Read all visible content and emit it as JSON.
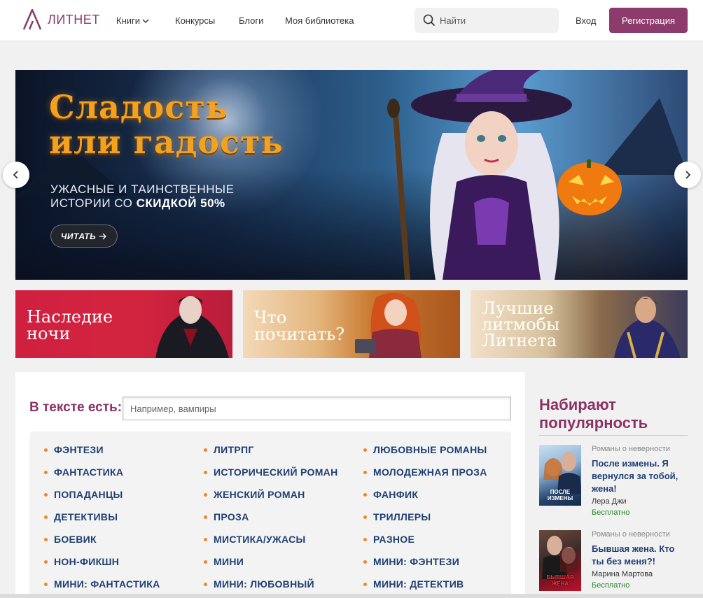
{
  "header": {
    "logo_text": "ЛИТНЕТ",
    "nav": {
      "books": "Книги",
      "contests": "Конкурсы",
      "blogs": "Блоги",
      "library": "Моя библиотека"
    },
    "search_placeholder": "Найти",
    "login": "Вход",
    "register": "Регистрация"
  },
  "hero": {
    "title_line1": "Сладость",
    "title_line2": "или гадость",
    "subtitle_line1": "УЖАСНЫЕ И ТАИНСТВЕННЫЕ",
    "subtitle_line2_plain": "ИСТОРИИ СО ",
    "subtitle_line2_bold": "СКИДКОЙ 50%",
    "button": "ЧИТАТЬ"
  },
  "promos": [
    {
      "line1": "Наследие",
      "line2": "ночи"
    },
    {
      "line1": "Что",
      "line2": "почитать?"
    },
    {
      "line1": "Лучшие",
      "line2": "литмобы",
      "line3": "Литнета"
    }
  ],
  "search_in_text": {
    "label": "В тексте есть:",
    "placeholder": "Например, вампиры"
  },
  "genres": {
    "col1": [
      "ФЭНТЕЗИ",
      "ФАНТАСТИКА",
      "ПОПАДАНЦЫ",
      "ДЕТЕКТИВЫ",
      "БОЕВИК",
      "НОН-ФИКШН",
      "МИНИ: ФАНТАСТИКА"
    ],
    "col2": [
      "ЛИТРПГ",
      "ИСТОРИЧЕСКИЙ РОМАН",
      "ЖЕНСКИЙ РОМАН",
      "ПРОЗА",
      "МИСТИКА/УЖАСЫ",
      "МИНИ",
      "МИНИ: ЛЮБОВНЫЙ"
    ],
    "col3": [
      "ЛЮБОВНЫЕ РОМАНЫ",
      "МОЛОДЕЖНАЯ ПРОЗА",
      "ФАНФИК",
      "ТРИЛЛЕРЫ",
      "РАЗНОЕ",
      "МИНИ: ФЭНТЕЗИ",
      "МИНИ: ДЕТЕКТИВ"
    ]
  },
  "popular": {
    "title": "Набирают популярность",
    "books": [
      {
        "genre": "Романы о неверности",
        "title": "После измены. Я вернулся за тобой, жена!",
        "author": "Лера Джи",
        "price": "Бесплатно",
        "cover_caption": "ПОСЛЕ ИЗМЕНЫ"
      },
      {
        "genre": "Романы о неверности",
        "title": "Бывшая жена. Кто ты без меня?!",
        "author": "Марина Мартова",
        "price": "Бесплатно",
        "cover_caption": "БЫВШАЯ ЖЕНА"
      }
    ]
  },
  "colors": {
    "brand": "#8d3b6c",
    "genre_link": "#1f3f73",
    "bullet": "#e88a2a",
    "free": "#2c8a2c"
  }
}
